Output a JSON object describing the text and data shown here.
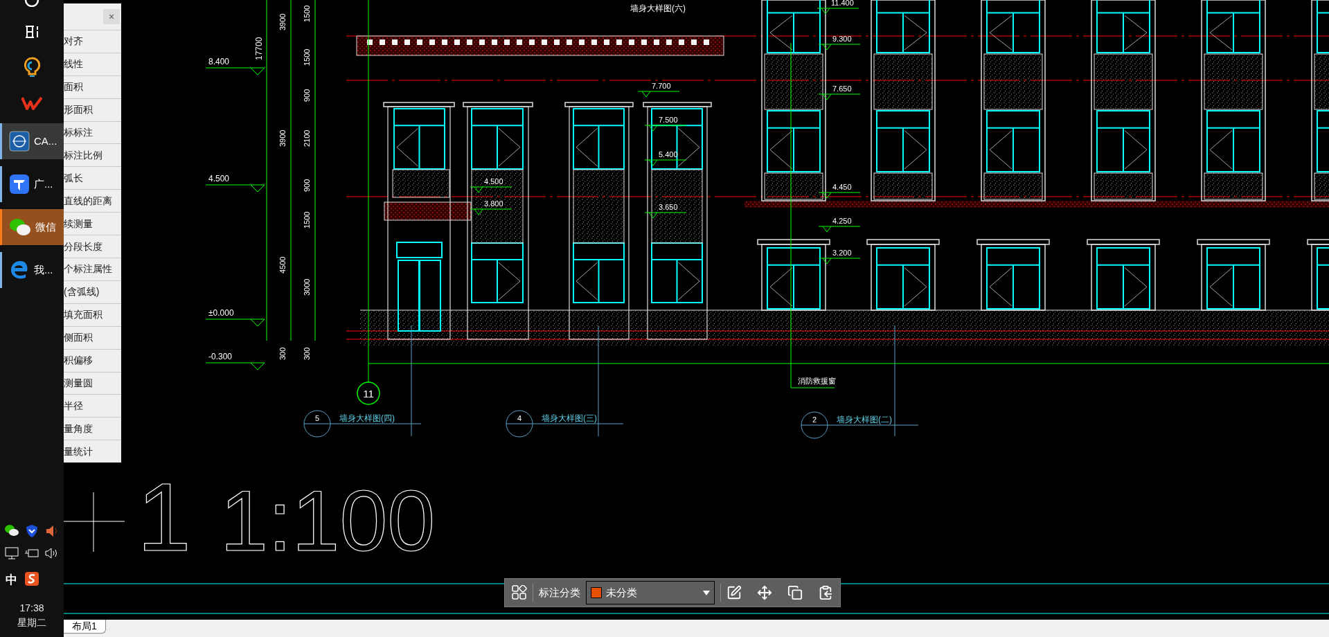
{
  "taskbar": {
    "apps": [
      {
        "kind": "cad",
        "label": "CA...",
        "selected": true,
        "flashing": false
      },
      {
        "kind": "tile",
        "label": "广...",
        "selected": false,
        "flashing": false
      },
      {
        "kind": "chat",
        "label": "微信",
        "selected": false,
        "flashing": true
      },
      {
        "kind": "browser",
        "label": "我...",
        "selected": false,
        "flashing": false
      }
    ],
    "tray": {
      "ime": "中",
      "time": "17:38",
      "day": "星期二"
    }
  },
  "measure_panel": {
    "close": "×",
    "items": [
      "对齐",
      "线性",
      "面积",
      "形面积",
      "标标注",
      "标注比例",
      "弧长",
      "直线的距离",
      "续测量",
      "分段长度",
      "个标注属性",
      "(含弧线)",
      "填充面积",
      "侧面积",
      "积偏移",
      "测量圆",
      "半径",
      "量角度",
      "量统计"
    ]
  },
  "drawing": {
    "top_callout": "墙身大样图(六)",
    "elevations": [
      "8.400",
      "4.500",
      "±0.000",
      "-0.300"
    ],
    "total_dimension": "17700",
    "floor_dimensions": [
      "3900",
      "3900",
      "4500",
      "300"
    ],
    "part_dimensions": [
      "1500",
      "1500",
      "900",
      "2100",
      "900",
      "1500",
      "3000",
      "300"
    ],
    "levels": [
      "7.700",
      "7.500",
      "5.400",
      "4.500",
      "3.800",
      "3.650",
      "11.400",
      "9.300",
      "7.650",
      "4.450",
      "4.250",
      "3.200"
    ],
    "axis_bubble": "11",
    "note": "消防救援窗",
    "detail_callouts": [
      {
        "number": "5",
        "title": "墙身大样图(四)"
      },
      {
        "number": "4",
        "title": "墙身大样图(三)"
      },
      {
        "number": "2",
        "title": "墙身大样图(二)"
      }
    ],
    "scale_text": [
      "1",
      "1:100"
    ]
  },
  "annotation_toolbar": {
    "label": "标注分类",
    "category": "未分类"
  },
  "layout_tabs": [
    {
      "label": "布局1",
      "selected": true
    }
  ]
}
